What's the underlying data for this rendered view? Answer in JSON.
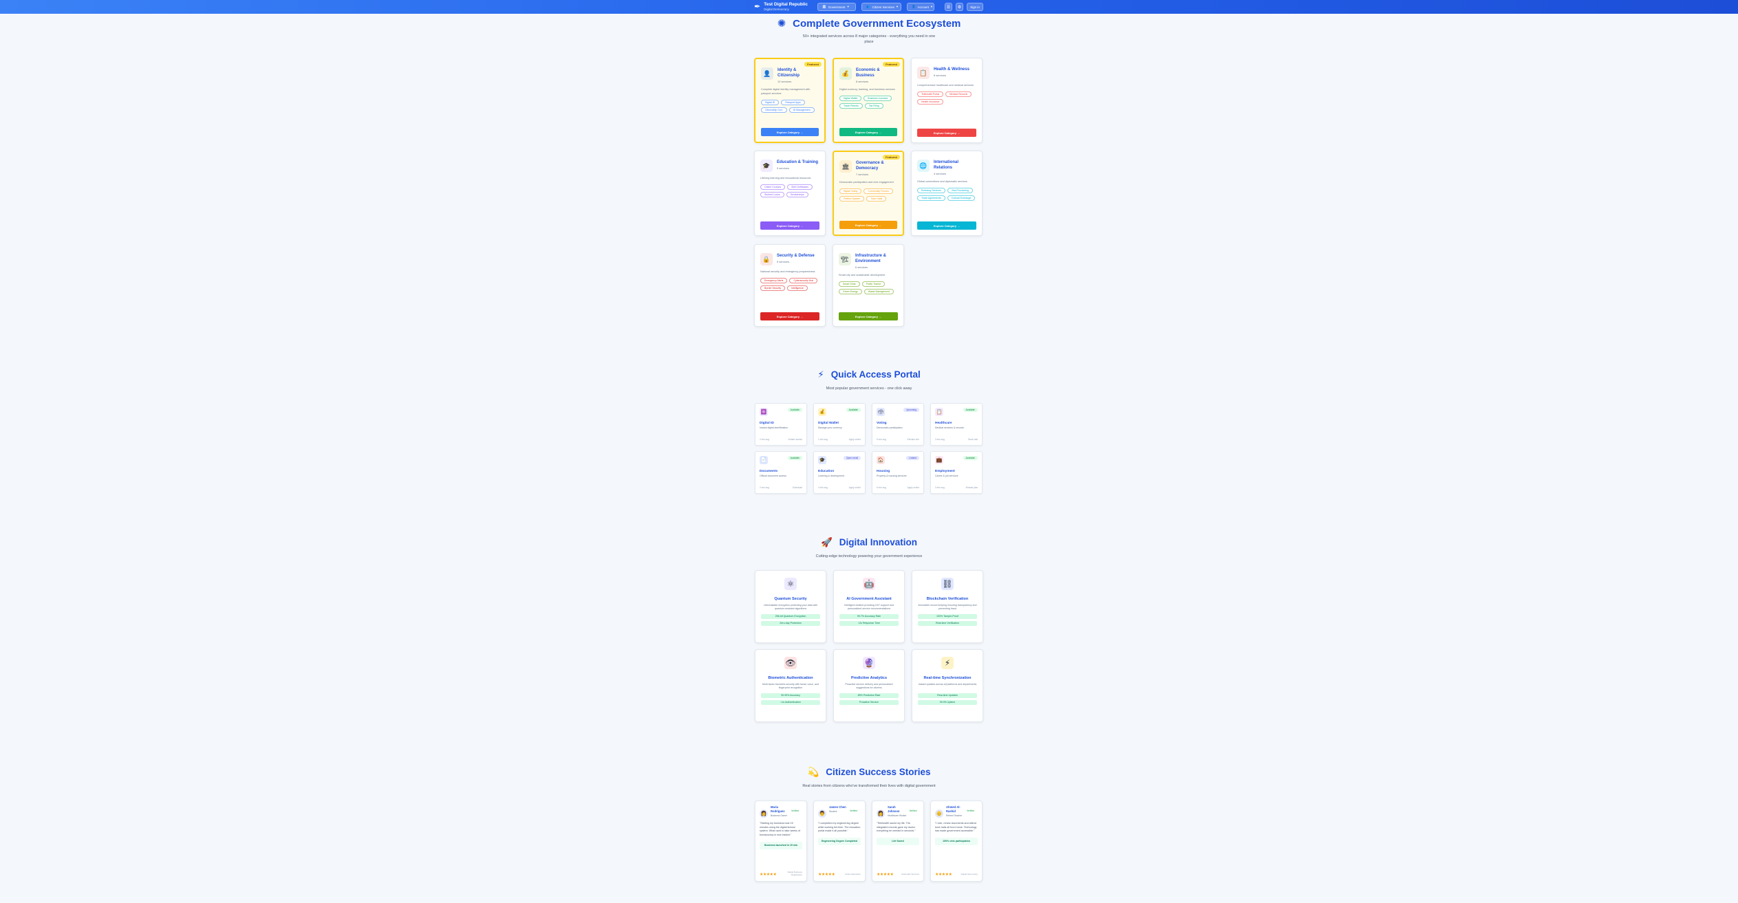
{
  "header": {
    "brand_title": "Test Digital Republic",
    "brand_subtitle": "Digital Democracy",
    "nav": [
      "Government",
      "Citizen Services",
      "Account"
    ],
    "icon_buttons": [
      "☰",
      "⚙"
    ],
    "signin_label": "Sign in"
  },
  "ecosystem": {
    "icon": "✺",
    "title": "Complete Government Ecosystem",
    "subtitle": "50+ integrated services across 8 major categories - everything you need in one place",
    "featured_label": "Featured",
    "explore_label": "Explore Category →",
    "categories": [
      {
        "title": "Identity & Citizenship",
        "count": "12 services",
        "icon": "user-icon",
        "glyph": "👤",
        "featured": true,
        "color": "#3b82f6",
        "desc": "Complete digital identity management with passport services",
        "tags": [
          "Digital ID",
          "Passport Apps",
          "Citizenship Cert.",
          "ID Management"
        ]
      },
      {
        "title": "Economic & Business",
        "count": "8 services",
        "icon": "money-bag-icon",
        "glyph": "💰",
        "featured": true,
        "color": "#10b981",
        "desc": "Digital currency, banking, and business services",
        "tags": [
          "Digital Wallet",
          "Business Licenses",
          "Trade Permits",
          "Tax Filing"
        ]
      },
      {
        "title": "Health & Wellness",
        "count": "6 services",
        "icon": "health-record-icon",
        "glyph": "📋",
        "featured": false,
        "color": "#ef4444",
        "desc": "Comprehensive healthcare and medical services",
        "tags": [
          "Telehealth Portal",
          "Medical Records",
          "Health Insurance"
        ]
      },
      {
        "title": "Education & Training",
        "count": "5 services",
        "icon": "graduation-cap-icon",
        "glyph": "🎓",
        "featured": false,
        "color": "#8b5cf6",
        "desc": "Lifelong learning and educational resources",
        "tags": [
          "Online Courses",
          "Skill Certificates",
          "Student Loans",
          "Scholarships"
        ]
      },
      {
        "title": "Governance & Democracy",
        "count": "7 services",
        "icon": "government-building-icon",
        "glyph": "🏛",
        "featured": true,
        "color": "#f59e0b",
        "desc": "Democratic participation and civic engagement",
        "tags": [
          "Digital Voting",
          "Community Forums",
          "Petition System",
          "Town Halls"
        ]
      },
      {
        "title": "International Relations",
        "count": "4 services",
        "icon": "globe-icon",
        "glyph": "🌐",
        "featured": false,
        "color": "#06b6d4",
        "desc": "Global connections and diplomatic services",
        "tags": [
          "Embassy Services",
          "Visa Processing",
          "Trade Agreements",
          "Cultural Exchange"
        ]
      },
      {
        "title": "Security & Defense",
        "count": "5 services",
        "icon": "lock-icon",
        "glyph": "🔒",
        "featured": false,
        "color": "#dc2626",
        "desc": "National security and emergency preparedness",
        "tags": [
          "Emergency Alerts",
          "Cybersecurity Hub",
          "Border Security",
          "Intelligence"
        ]
      },
      {
        "title": "Infrastructure & Environment",
        "count": "6 services",
        "icon": "infrastructure-icon",
        "glyph": "🏗",
        "featured": false,
        "color": "#65a30d",
        "desc": "Smart city and sustainable development",
        "tags": [
          "Smart Grids",
          "Public Transit",
          "Green Energy",
          "Waste Management"
        ]
      }
    ]
  },
  "quick_access": {
    "icon": "⚡",
    "title": "Quick Access Portal",
    "subtitle": "Most popular government services - one click away",
    "items": [
      {
        "title": "Digital ID",
        "desc": "Instant digital identification",
        "status": "Available",
        "tone": "green",
        "glyph": "🆔",
        "icon": "id-card-icon",
        "left": "2 min avg",
        "right": "Instant access"
      },
      {
        "title": "Digital Wallet",
        "desc": "Manage your currency",
        "status": "Available",
        "tone": "green",
        "glyph": "💰",
        "icon": "wallet-icon",
        "left": "1 min avg",
        "right": "Apply online"
      },
      {
        "title": "Voting",
        "desc": "Democratic participation",
        "status": "Upcoming",
        "tone": "blue",
        "glyph": "🗳",
        "icon": "ballot-box-icon",
        "left": "5 min avg",
        "right": "Election info"
      },
      {
        "title": "Healthcare",
        "desc": "Medical services & records",
        "status": "Available",
        "tone": "green",
        "glyph": "📋",
        "icon": "clipboard-icon",
        "left": "3 min avg",
        "right": "Book visit"
      },
      {
        "title": "Documents",
        "desc": "Official document access",
        "status": "Available",
        "tone": "green",
        "glyph": "📄",
        "icon": "document-icon",
        "left": "2 min avg",
        "right": "Download"
      },
      {
        "title": "Education",
        "desc": "Learning & development",
        "status": "Open enroll",
        "tone": "blue",
        "glyph": "🎓",
        "icon": "graduation-cap-icon",
        "left": "4 min avg",
        "right": "Apply online"
      },
      {
        "title": "Housing",
        "desc": "Property & housing services",
        "status": "Limited",
        "tone": "blue",
        "glyph": "🏠",
        "icon": "house-icon",
        "left": "6 min avg",
        "right": "Apply online"
      },
      {
        "title": "Employment",
        "desc": "Career & job services",
        "status": "Available",
        "tone": "green",
        "glyph": "💼",
        "icon": "briefcase-icon",
        "left": "3 min avg",
        "right": "Browse jobs"
      }
    ]
  },
  "innovation": {
    "icon": "🚀",
    "title": "Digital Innovation",
    "subtitle": "Cutting-edge technology powering your government experience",
    "items": [
      {
        "title": "Quantum Security",
        "glyph": "⚛",
        "icon": "atom-icon",
        "desc": "Unbreakable encryption protecting your data with quantum-resistant algorithms",
        "stats": [
          "256-bit Quantum Encryption",
          "Zero-day Protection"
        ]
      },
      {
        "title": "AI Government Assistant",
        "glyph": "🤖",
        "icon": "robot-icon",
        "desc": "Intelligent chatbot providing 24/7 support and personalized service recommendations",
        "stats": [
          "99.7% Accuracy Rate",
          "<2s Response Time"
        ]
      },
      {
        "title": "Blockchain Verification",
        "glyph": "⛓",
        "icon": "chain-icon",
        "desc": "Immutable record keeping ensuring transparency and preventing fraud",
        "stats": [
          "100% Tamper-Proof",
          "Real-time Verification"
        ]
      },
      {
        "title": "Biometric Authentication",
        "glyph": "👁",
        "icon": "eye-icon",
        "desc": "Multi-factor biometric security with facial, voice, and fingerprint recognition",
        "stats": [
          "99.99% Accuracy",
          "<1s Authentication"
        ]
      },
      {
        "title": "Predictive Analytics",
        "glyph": "🔮",
        "icon": "crystal-ball-icon",
        "desc": "Proactive service delivery and personalized suggestions for citizens",
        "stats": [
          "85% Prediction Rate",
          "Proactive Service"
        ]
      },
      {
        "title": "Real-time Synchronization",
        "glyph": "⚡",
        "icon": "lightning-icon",
        "desc": "Instant updates across all platforms and departments",
        "stats": [
          "Real-time Updates",
          "99.9% Uptime"
        ]
      }
    ]
  },
  "stories": {
    "icon": "💫",
    "title": "Citizen Success Stories",
    "subtitle": "Real stories from citizens who've transformed their lives with digital government",
    "items": [
      {
        "name": "Maria Rodriguez",
        "location": "Business Owner",
        "verified": "Verified",
        "glyph": "👩",
        "quote": "\"Starting my business took 15 minutes using the digital license system. What used to take weeks of bureaucracy is now instant.\"",
        "impact": "Business launched in 15 min",
        "rating": "★★★★★",
        "meta": "Digital Business Registration"
      },
      {
        "name": "James Chen",
        "location": "Student",
        "verified": "Verified",
        "glyph": "👨",
        "quote": "\"I completed my engineering degree while working full-time. The education portal made it all possible.\"",
        "impact": "Engineering Degree Completed",
        "rating": "★★★★★",
        "meta": "Online Education"
      },
      {
        "name": "Sarah Johnson",
        "location": "Healthcare Worker",
        "verified": "Verified",
        "glyph": "👩",
        "quote": "\"Telehealth saved my life. The integrated records gave my doctor everything he needed in seconds.\"",
        "impact": "Life Saved",
        "rating": "★★★★★",
        "meta": "Telehealth Services"
      },
      {
        "name": "Ahmed Al-Rashid",
        "location": "Retired Teacher",
        "verified": "Verified",
        "glyph": "👴",
        "quote": "\"I vote, renew documents and attend town halls all from home. Technology has made government accessible.\"",
        "impact": "100% civic participation",
        "rating": "★★★★★",
        "meta": "Digital Democracy"
      }
    ]
  }
}
